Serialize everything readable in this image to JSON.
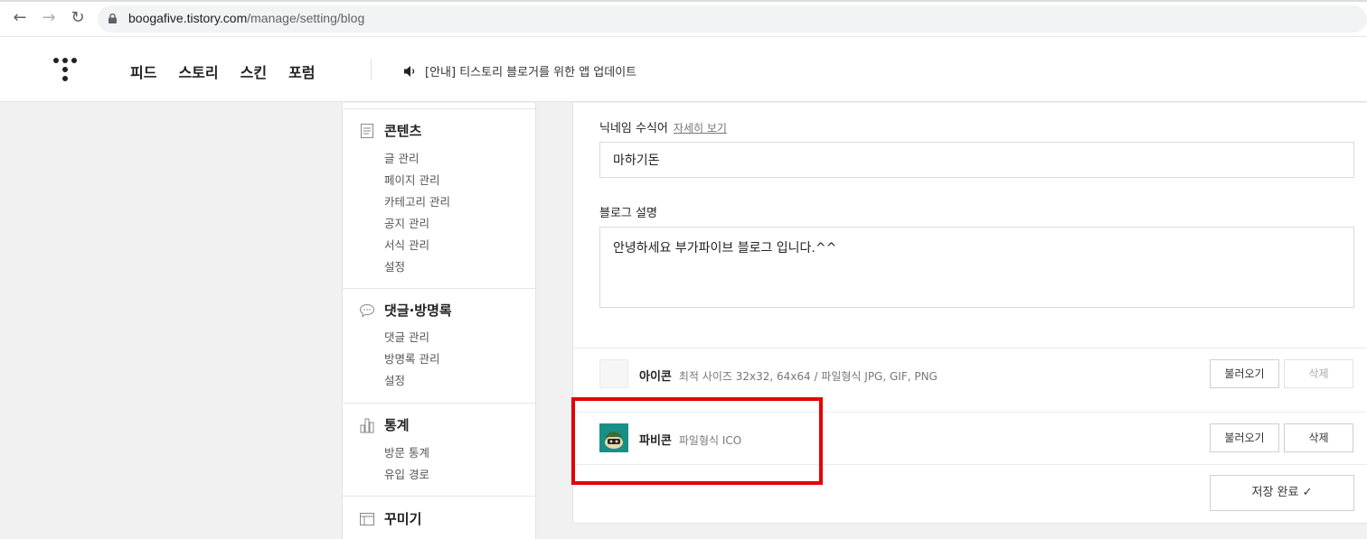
{
  "browser": {
    "url_host": "boogafive.tistory.com",
    "url_path": "/manage/setting/blog"
  },
  "header": {
    "nav": [
      "피드",
      "스토리",
      "스킨",
      "포럼"
    ],
    "notice_text": "[안내] 티스토리 블로거를 위한 앱 업데이트"
  },
  "sidebar": {
    "groups": [
      {
        "title": "콘텐츠",
        "icon": "document-icon",
        "items": [
          "글 관리",
          "페이지 관리",
          "카테고리 관리",
          "공지 관리",
          "서식 관리",
          "설정"
        ]
      },
      {
        "title": "댓글·방명록",
        "icon": "speech-bubble-icon",
        "items": [
          "댓글 관리",
          "방명록 관리",
          "설정"
        ]
      },
      {
        "title": "통계",
        "icon": "bar-chart-icon",
        "items": [
          "방문 통계",
          "유입 경로"
        ]
      },
      {
        "title": "꾸미기",
        "icon": "layout-icon",
        "items": []
      }
    ]
  },
  "form": {
    "nickname_label": "닉네임 수식어",
    "detail_link": "자세히 보기",
    "nickname_value": "마하기돈",
    "description_label": "블로그 설명",
    "description_value": "안녕하세요 부가파이브 블로그 입니다.^^",
    "icon_row": {
      "label": "아이콘",
      "desc": "최적 사이즈 32x32, 64x64 / 파일형식 JPG, GIF, PNG",
      "load_button": "불러오기",
      "delete_button": "삭제"
    },
    "favicon_row": {
      "label": "파비콘",
      "desc": "파일형식 ICO",
      "load_button": "불러오기",
      "delete_button": "삭제"
    },
    "save_button": "저장 완료",
    "save_check": "✓"
  },
  "colors": {
    "highlight": "#e60000",
    "favicon_bg": "#1a8f86"
  }
}
